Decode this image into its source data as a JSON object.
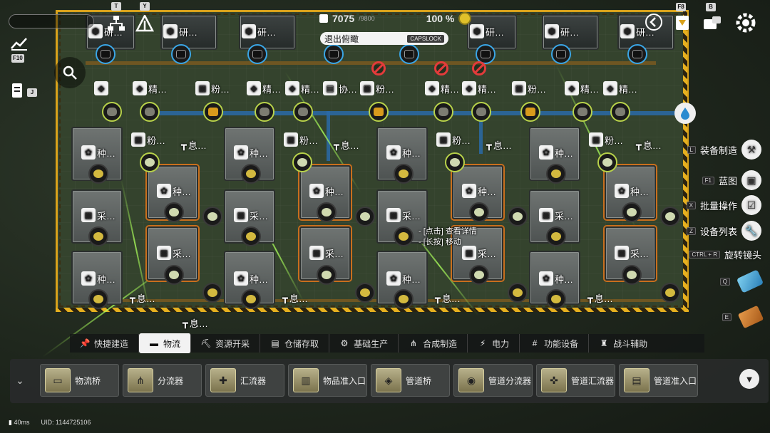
{
  "hud": {
    "resource_value": "7075",
    "resource_cap": "/9800",
    "percent": "100 %",
    "exit_hint": "退出俯瞰",
    "exit_key": "CAPSLOCK",
    "key_t": "T",
    "key_y": "Y",
    "key_f10": "F10",
    "key_j": "J",
    "key_f8": "F8",
    "key_b": "B"
  },
  "scene": {
    "research_label": "研…",
    "refine_label": "精…",
    "powder_label": "粉…",
    "coop_label": "协…",
    "plant_label": "种…",
    "harvest_label": "采…",
    "info_label": "息…"
  },
  "context_menu": {
    "line1": "- [点击] 查看详情",
    "line2": "- [长按] 移动"
  },
  "right_menu": [
    {
      "key": "L",
      "label": "装备制造"
    },
    {
      "key": "F1",
      "label": "蓝图"
    },
    {
      "key": "X",
      "label": "批量操作"
    },
    {
      "key": "Z",
      "label": "设备列表"
    },
    {
      "key": "CTRL + R",
      "label": "旋转镜头"
    },
    {
      "key": "Q",
      "label": ""
    },
    {
      "key": "E",
      "label": ""
    }
  ],
  "categories": [
    {
      "label": "快捷建造",
      "icon": "pin-icon"
    },
    {
      "label": "物流",
      "icon": "logistics-icon"
    },
    {
      "label": "资源开采",
      "icon": "pickaxe-icon"
    },
    {
      "label": "仓储存取",
      "icon": "storage-icon"
    },
    {
      "label": "基础生产",
      "icon": "gear-icon"
    },
    {
      "label": "合成制造",
      "icon": "merge-icon"
    },
    {
      "label": "电力",
      "icon": "power-icon"
    },
    {
      "label": "功能设备",
      "icon": "grid-icon"
    },
    {
      "label": "战斗辅助",
      "icon": "tower-icon"
    }
  ],
  "items": [
    {
      "label": "物流桥"
    },
    {
      "label": "分流器"
    },
    {
      "label": "汇流器"
    },
    {
      "label": "物品准入口"
    },
    {
      "label": "管道桥"
    },
    {
      "label": "管道分流器"
    },
    {
      "label": "管道汇流器"
    },
    {
      "label": "管道准入口"
    }
  ],
  "status": {
    "latency": "40ms",
    "uid": "UID: 1144725106"
  },
  "colors": {
    "accent_yellow": "#d9a21b",
    "pipe_blue": "#2a6aa8",
    "ban_red": "#e33b3b"
  }
}
